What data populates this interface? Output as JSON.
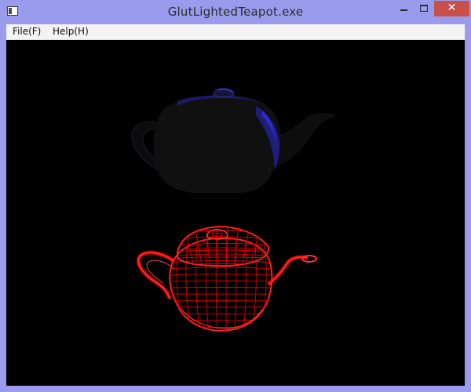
{
  "window": {
    "title": "GlutLightedTeapot.exe",
    "close_glyph": "✕",
    "icons": {
      "app": "app-window-icon",
      "minimize": "minimize-icon",
      "maximize": "maximize-icon",
      "close": "close-icon"
    },
    "colors": {
      "frame": "#9b9bee",
      "close_button": "#c7504a"
    }
  },
  "menu": {
    "items": [
      {
        "label": "File(F)"
      },
      {
        "label": "Help(H)"
      }
    ]
  },
  "viewport": {
    "background": "#000000",
    "objects": [
      {
        "name": "solid-teapot",
        "color": "#0a0a12",
        "highlight": "#1c1cc8"
      },
      {
        "name": "wireframe-teapot",
        "color": "#e00000"
      }
    ]
  }
}
